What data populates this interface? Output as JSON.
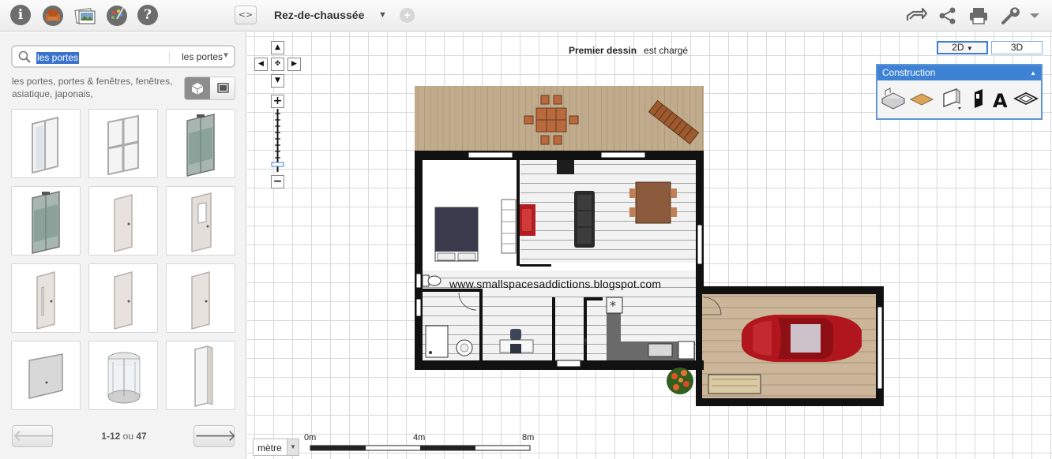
{
  "toolbar": {
    "info_glyph": "i",
    "help_glyph": "?",
    "nav_arrows": "<>",
    "level_name": "Rez-de-chaussée",
    "add_level_glyph": "+"
  },
  "search": {
    "query": "les portes",
    "category": "les portes",
    "tags": "les portes, portes & fenêtres, fenêtres, asiatique, japonais,"
  },
  "catalog": {
    "items": [
      {
        "icon": "sliding-window-icon"
      },
      {
        "icon": "grid-window-icon"
      },
      {
        "icon": "elevator-door-icon"
      },
      {
        "icon": "elevator-door-icon"
      },
      {
        "icon": "plain-door-icon"
      },
      {
        "icon": "glass-panel-door-icon"
      },
      {
        "icon": "narrow-glass-door-icon"
      },
      {
        "icon": "plain-door-icon"
      },
      {
        "icon": "plain-door-icon"
      },
      {
        "icon": "garage-door-icon"
      },
      {
        "icon": "revolving-door-icon"
      },
      {
        "icon": "open-door-icon"
      }
    ],
    "pager": {
      "range": "1-12",
      "separator": "ou",
      "total": "47"
    }
  },
  "canvas": {
    "status_bold": "Premier dessin",
    "status_text": "est chargé",
    "view_2d": "2D",
    "view_3d": "3D",
    "construction_title": "Construction",
    "watermark": "www.smallspacesaddictions.blogspot.com",
    "scale": {
      "unit": "mètre",
      "ticks": [
        "0m",
        "4m",
        "8m"
      ]
    }
  },
  "colors": {
    "accent": "#3d82d4",
    "wall": "#111111",
    "terrace": "#bfa98a",
    "garage_floor": "#c9b497",
    "sofa": "#2a2a2a",
    "bed": "#3b3a4c",
    "car": "#b0161c"
  }
}
